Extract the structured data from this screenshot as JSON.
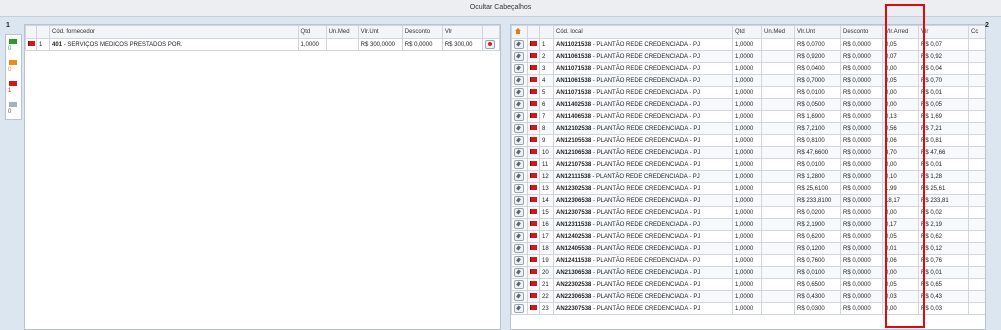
{
  "header": {
    "toggle_label": "Ocultar Cabeçalhos"
  },
  "left_strip": {
    "group_number": "1",
    "legend": [
      {
        "flag": "green",
        "color": "#2e9a2e",
        "count": "0"
      },
      {
        "flag": "orange",
        "color": "#f08a1c",
        "count": "0"
      },
      {
        "flag": "red",
        "color": "#d6161b",
        "count": "1"
      },
      {
        "flag": "gray",
        "color": "#a8b0bb",
        "count": "0"
      }
    ]
  },
  "supplier_table": {
    "columns": [
      "",
      "",
      "Cód. fornecedor",
      "Qtd",
      "Un.Med",
      "Vlr.Unt",
      "Desconto",
      "Vlr",
      ""
    ],
    "rows": [
      {
        "index": "1",
        "code": "401",
        "name": "- SERVIÇOS MEDICOS PRESTADOS POR.",
        "qtd": "1,0000",
        "unmed": "",
        "vlrunt": "R$ 300,0000",
        "desconto": "R$ 0,0000",
        "vlr": "R$ 300,00"
      }
    ]
  },
  "items_table": {
    "columns": [
      "",
      "",
      "",
      "Cód. local",
      "Qtd",
      "Un.Med",
      "Vlr.Unt",
      "Desconto",
      "Vlr.Arred",
      "Vlr",
      "Cc"
    ],
    "rows": [
      {
        "index": "1",
        "code": "AN11021538",
        "desc": "- PLANTÃO REDE CREDENCIADA - PJ",
        "qtd": "1,0000",
        "vlrunt": "R$ 0,0700",
        "desconto": "R$ 0,0000",
        "arred": "0,05",
        "vlr": "R$ 0,07"
      },
      {
        "index": "2",
        "code": "AN11061538",
        "desc": "- PLANTÃO REDE CREDENCIADA - PJ",
        "qtd": "1,0000",
        "vlrunt": "R$ 0,9200",
        "desconto": "R$ 0,0000",
        "arred": "0,07",
        "vlr": "R$ 0,92"
      },
      {
        "index": "3",
        "code": "AN11071538",
        "desc": "- PLANTÃO REDE CREDENCIADA - PJ",
        "qtd": "1,0000",
        "vlrunt": "R$ 0,0400",
        "desconto": "R$ 0,0000",
        "arred": "0,00",
        "vlr": "R$ 0,04"
      },
      {
        "index": "4",
        "code": "AN11061538",
        "desc": "- PLANTÃO REDE CREDENCIADA - PJ",
        "qtd": "1,0000",
        "vlrunt": "R$ 0,7000",
        "desconto": "R$ 0,0000",
        "arred": "0,05",
        "vlr": "R$ 0,70"
      },
      {
        "index": "5",
        "code": "AN11071538",
        "desc": "- PLANTÃO REDE CREDENCIADA - PJ",
        "qtd": "1,0000",
        "vlrunt": "R$ 0,0100",
        "desconto": "R$ 0,0000",
        "arred": "0,00",
        "vlr": "R$ 0,01"
      },
      {
        "index": "6",
        "code": "AN11402538",
        "desc": "- PLANTÃO REDE CREDENCIADA - PJ",
        "qtd": "1,0000",
        "vlrunt": "R$ 0,0500",
        "desconto": "R$ 0,0000",
        "arred": "0,00",
        "vlr": "R$ 0,05"
      },
      {
        "index": "7",
        "code": "AN11406538",
        "desc": "- PLANTÃO REDE CREDENCIADA - PJ",
        "qtd": "1,0000",
        "vlrunt": "R$ 1,6900",
        "desconto": "R$ 0,0000",
        "arred": "0,13",
        "vlr": "R$ 1,69"
      },
      {
        "index": "8",
        "code": "AN12102538",
        "desc": "- PLANTÃO REDE CREDENCIADA - PJ",
        "qtd": "1,0000",
        "vlrunt": "R$ 7,2100",
        "desconto": "R$ 0,0000",
        "arred": "0,56",
        "vlr": "R$ 7,21"
      },
      {
        "index": "9",
        "code": "AN12105538",
        "desc": "- PLANTÃO REDE CREDENCIADA - PJ",
        "qtd": "1,0000",
        "vlrunt": "R$ 0,8100",
        "desconto": "R$ 0,0000",
        "arred": "0,06",
        "vlr": "R$ 0,81"
      },
      {
        "index": "10",
        "code": "AN12106538",
        "desc": "- PLANTÃO REDE CREDENCIADA - PJ",
        "qtd": "1,0000",
        "vlrunt": "R$ 47,6600",
        "desconto": "R$ 0,0000",
        "arred": "3,70",
        "vlr": "R$ 47,66"
      },
      {
        "index": "11",
        "code": "AN12107538",
        "desc": "- PLANTÃO REDE CREDENCIADA - PJ",
        "qtd": "1,0000",
        "vlrunt": "R$ 0,0100",
        "desconto": "R$ 0,0000",
        "arred": "0,00",
        "vlr": "R$ 0,01"
      },
      {
        "index": "12",
        "code": "AN12111538",
        "desc": "- PLANTÃO REDE CREDENCIADA - PJ",
        "qtd": "1,0000",
        "vlrunt": "R$ 1,2800",
        "desconto": "R$ 0,0000",
        "arred": "0,10",
        "vlr": "R$ 1,28"
      },
      {
        "index": "13",
        "code": "AN12302538",
        "desc": "- PLANTÃO REDE CREDENCIADA - PJ",
        "qtd": "1,0000",
        "vlrunt": "R$ 25,6100",
        "desconto": "R$ 0,0000",
        "arred": "1,99",
        "vlr": "R$ 25,61"
      },
      {
        "index": "14",
        "code": "AN12306538",
        "desc": "- PLANTÃO REDE CREDENCIADA - PJ",
        "qtd": "1,0000",
        "vlrunt": "R$ 233,8100",
        "desconto": "R$ 0,0000",
        "arred": "18,17",
        "vlr": "R$ 233,81"
      },
      {
        "index": "15",
        "code": "AN12307538",
        "desc": "- PLANTÃO REDE CREDENCIADA - PJ",
        "qtd": "1,0000",
        "vlrunt": "R$ 0,0200",
        "desconto": "R$ 0,0000",
        "arred": "0,00",
        "vlr": "R$ 0,02"
      },
      {
        "index": "16",
        "code": "AN12311538",
        "desc": "- PLANTÃO REDE CREDENCIADA - PJ",
        "qtd": "1,0000",
        "vlrunt": "R$ 2,1900",
        "desconto": "R$ 0,0000",
        "arred": "0,17",
        "vlr": "R$ 2,19"
      },
      {
        "index": "17",
        "code": "AN12402538",
        "desc": "- PLANTÃO REDE CREDENCIADA - PJ",
        "qtd": "1,0000",
        "vlrunt": "R$ 0,6200",
        "desconto": "R$ 0,0000",
        "arred": "0,05",
        "vlr": "R$ 0,62"
      },
      {
        "index": "18",
        "code": "AN12405538",
        "desc": "- PLANTÃO REDE CREDENCIADA - PJ",
        "qtd": "1,0000",
        "vlrunt": "R$ 0,1200",
        "desconto": "R$ 0,0000",
        "arred": "0,01",
        "vlr": "R$ 0,12"
      },
      {
        "index": "19",
        "code": "AN12411538",
        "desc": "- PLANTÃO REDE CREDENCIADA - PJ",
        "qtd": "1,0000",
        "vlrunt": "R$ 0,7600",
        "desconto": "R$ 0,0000",
        "arred": "0,06",
        "vlr": "R$ 0,76"
      },
      {
        "index": "20",
        "code": "AN21306538",
        "desc": "- PLANTÃO REDE CREDENCIADA - PJ",
        "qtd": "1,0000",
        "vlrunt": "R$ 0,0100",
        "desconto": "R$ 0,0000",
        "arred": "0,00",
        "vlr": "R$ 0,01"
      },
      {
        "index": "21",
        "code": "AN22302538",
        "desc": "- PLANTÃO REDE CREDENCIADA - PJ",
        "qtd": "1,0000",
        "vlrunt": "R$ 0,6500",
        "desconto": "R$ 0,0000",
        "arred": "0,05",
        "vlr": "R$ 0,65"
      },
      {
        "index": "22",
        "code": "AN22306538",
        "desc": "- PLANTÃO REDE CREDENCIADA - PJ",
        "qtd": "1,0000",
        "vlrunt": "R$ 0,4300",
        "desconto": "R$ 0,0000",
        "arred": "0,03",
        "vlr": "R$ 0,43"
      },
      {
        "index": "23",
        "code": "AN22307538",
        "desc": "- PLANTÃO REDE CREDENCIADA - PJ",
        "qtd": "1,0000",
        "vlrunt": "R$ 0,0300",
        "desconto": "R$ 0,0000",
        "arred": "0,00",
        "vlr": "R$ 0,03"
      }
    ]
  },
  "right_edge_number": "2"
}
